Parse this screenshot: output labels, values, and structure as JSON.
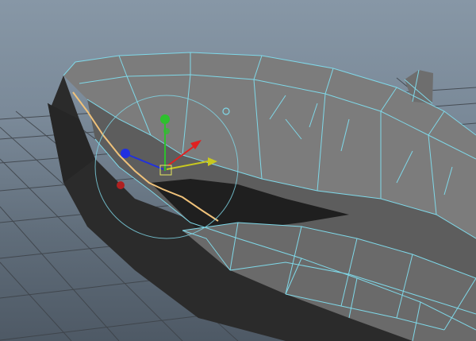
{
  "viewport": {
    "label": "",
    "colors": {
      "background_top": "#8797a6",
      "background_bottom": "#4e5965",
      "ground_grid": "#3a3f44",
      "mesh_fill_light": "#7a7a7a",
      "mesh_fill_dark": "#2e2e2e",
      "wireframe": "#7fd8e8",
      "selected_edge_loop": "#f0c27a",
      "manipulator_x": "#c8c820",
      "manipulator_y": "#2ec02e",
      "manipulator_z": "#2030e0",
      "manipulator_view": "#e02020"
    },
    "icons": [
      "rotate-manipulator-icon",
      "move-manipulator-icon",
      "pivot-icon"
    ]
  }
}
